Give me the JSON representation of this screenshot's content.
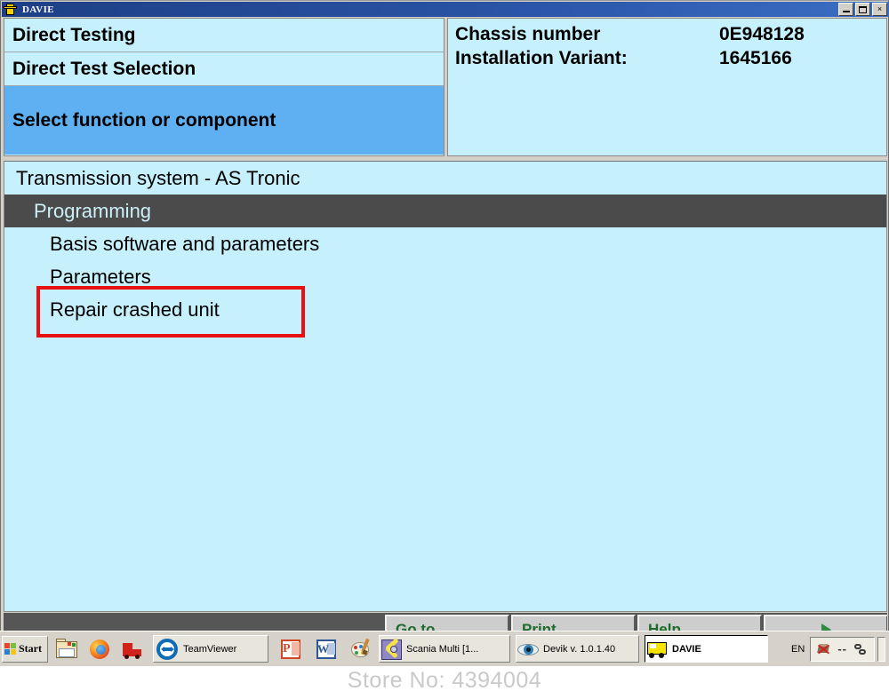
{
  "window": {
    "title": "DAVIE",
    "icon": "davie-truck-icon",
    "controls": {
      "minimize": "minimize",
      "maximize": "maximize",
      "close": "×"
    }
  },
  "header": {
    "left_rows": [
      {
        "label": "Direct Testing"
      },
      {
        "label": "Direct Test Selection"
      },
      {
        "label": "Select function or component"
      }
    ],
    "info": [
      {
        "key": "Chassis number",
        "value": "0E948128"
      },
      {
        "key": "Installation Variant:",
        "value": "1645166"
      }
    ]
  },
  "tree": {
    "items": [
      {
        "label": "Transmission system - AS Tronic",
        "level": 0,
        "selected": false,
        "highlighted": false
      },
      {
        "label": "Programming",
        "level": 1,
        "selected": true,
        "highlighted": false
      },
      {
        "label": "Basis software and parameters",
        "level": 2,
        "selected": false,
        "highlighted": false
      },
      {
        "label": "Parameters",
        "level": 2,
        "selected": false,
        "highlighted": false
      },
      {
        "label": "Repair crashed unit",
        "level": 2,
        "selected": false,
        "highlighted": true
      }
    ]
  },
  "buttons": [
    {
      "label": "Go to",
      "icon": ""
    },
    {
      "label": "Print",
      "icon": ""
    },
    {
      "label": "Help",
      "icon": ""
    },
    {
      "label": "",
      "icon": "next-arrow-icon"
    }
  ],
  "taskbar": {
    "start": "Start",
    "quick_launch": [
      {
        "name": "show-desktop-folder-icon"
      },
      {
        "name": "firefox-icon"
      },
      {
        "name": "red-truck-icon"
      }
    ],
    "teamviewer": {
      "label": "TeamViewer",
      "icon": "teamviewer-icon"
    },
    "tray_launch": [
      {
        "name": "powerpoint-icon"
      },
      {
        "name": "word-icon"
      },
      {
        "name": "paint-icon"
      }
    ],
    "windows": [
      {
        "label": "Scania Multi   [1...",
        "icon": "scania-multi-icon",
        "active": false
      },
      {
        "label": "Devik v. 1.0.1.40",
        "icon": "devik-eye-icon",
        "active": false
      },
      {
        "label": "DAVIE",
        "icon": "davie-truck-icon",
        "active": true
      }
    ],
    "tray": {
      "language": "EN",
      "dash": "--",
      "icons": [
        {
          "name": "network-disconnected-icon"
        },
        {
          "name": "network-link-icon"
        }
      ]
    }
  },
  "watermark": {
    "text": "Store No: 4394004"
  },
  "colors": {
    "panel_cyan": "#c6f0fb",
    "panel_blue": "#5fb0f3",
    "selected_row": "#4b4b4b",
    "selected_text": "#cdeff8",
    "highlight_red": "#e81010",
    "button_green_text": "#1d6b2b",
    "titlebar_blue": "#1d3f85"
  }
}
